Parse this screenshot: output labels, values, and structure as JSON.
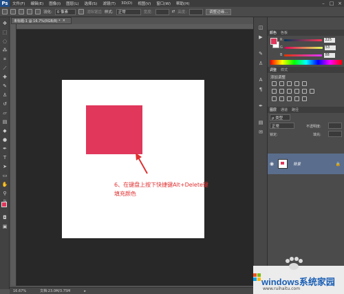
{
  "app": {
    "logo": "Ps"
  },
  "menu": [
    "文件(F)",
    "编辑(E)",
    "图像(I)",
    "图层(L)",
    "选择(S)",
    "滤镜(T)",
    "3D(D)",
    "视图(V)",
    "窗口(W)",
    "帮助(H)"
  ],
  "options_bar": {
    "feather_label": "羽化:",
    "feather_value": "0 像素",
    "antialias_label": "消除锯齿",
    "style_label": "样式:",
    "style_value": "正常",
    "width_label": "宽度:",
    "height_label": "高度:",
    "refine_button": "调整边缘..."
  },
  "document": {
    "tab_title": "未标题-1 @ 16.7%(RGB/8) *",
    "annotation_line1": "6、在键盘上按下快捷键Alt+Delete键",
    "annotation_line2": "填充颜色",
    "fg_color": "#e0375b"
  },
  "status": {
    "zoom": "16.67%",
    "doc_info": "文档:23.0M/3.75M"
  },
  "panels": {
    "color_tabs": [
      "颜色",
      "色板"
    ],
    "r_label": "R",
    "r_value": "225",
    "g_label": "G",
    "g_value": "53",
    "b_label": "B",
    "b_value": "88",
    "adjust_tabs": [
      "调整",
      "样式"
    ],
    "adjust_title": "添加调整",
    "layer_tabs": [
      "图层",
      "通道",
      "路径"
    ],
    "kind_label": "ρ 类型",
    "blend_mode": "正常",
    "opacity_label": "不透明度:",
    "lock_label": "锁定:",
    "fill_label": "填充:",
    "layer_name": "背景"
  },
  "watermark": {
    "text": "windows系统家园",
    "url": "www.ruihaitu.com"
  }
}
